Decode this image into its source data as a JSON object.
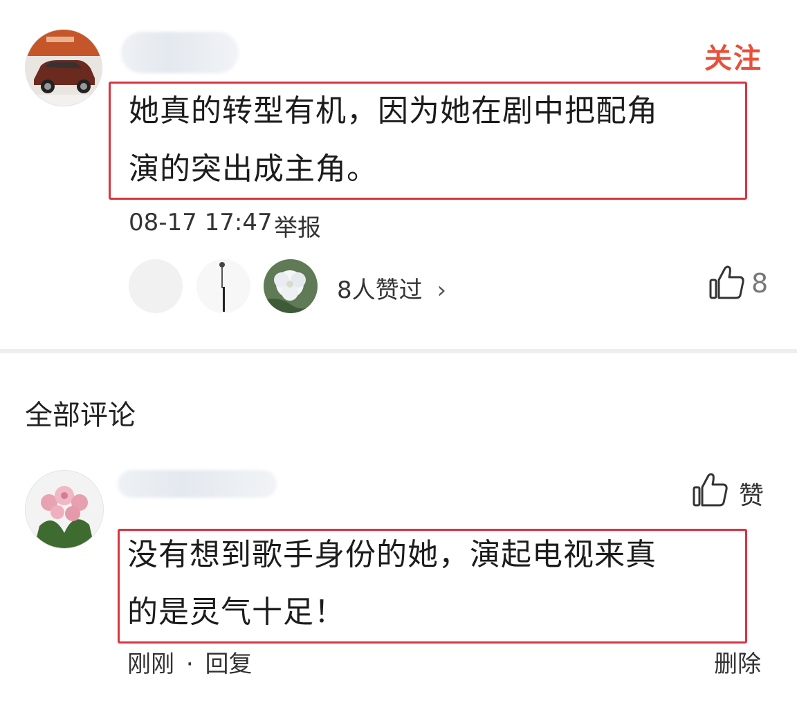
{
  "top_comment": {
    "follow_label": "关注",
    "text_line1": "她真的转型有机，因为她在剧中把配角",
    "text_line2": "演的突出成主角。",
    "timestamp": "08-17 17:47",
    "report_label": "举报",
    "likers_text": "8人赞过",
    "likers_chevron": "›",
    "like_icon": "thumbs-up-icon",
    "like_count": "8"
  },
  "all_comments": {
    "title": "全部评论"
  },
  "reply": {
    "like_label": "赞",
    "like_icon": "thumbs-up-icon",
    "text_line1": "没有想到歌手身份的她，演起电视来真",
    "text_line2": "的是灵气十足！",
    "time_label": "刚刚",
    "separator": "·",
    "reply_label": "回复",
    "delete_label": "删除"
  },
  "colors": {
    "follow": "#e8503a",
    "highlight_border": "#d9333f",
    "divider": "#eeeeee"
  }
}
